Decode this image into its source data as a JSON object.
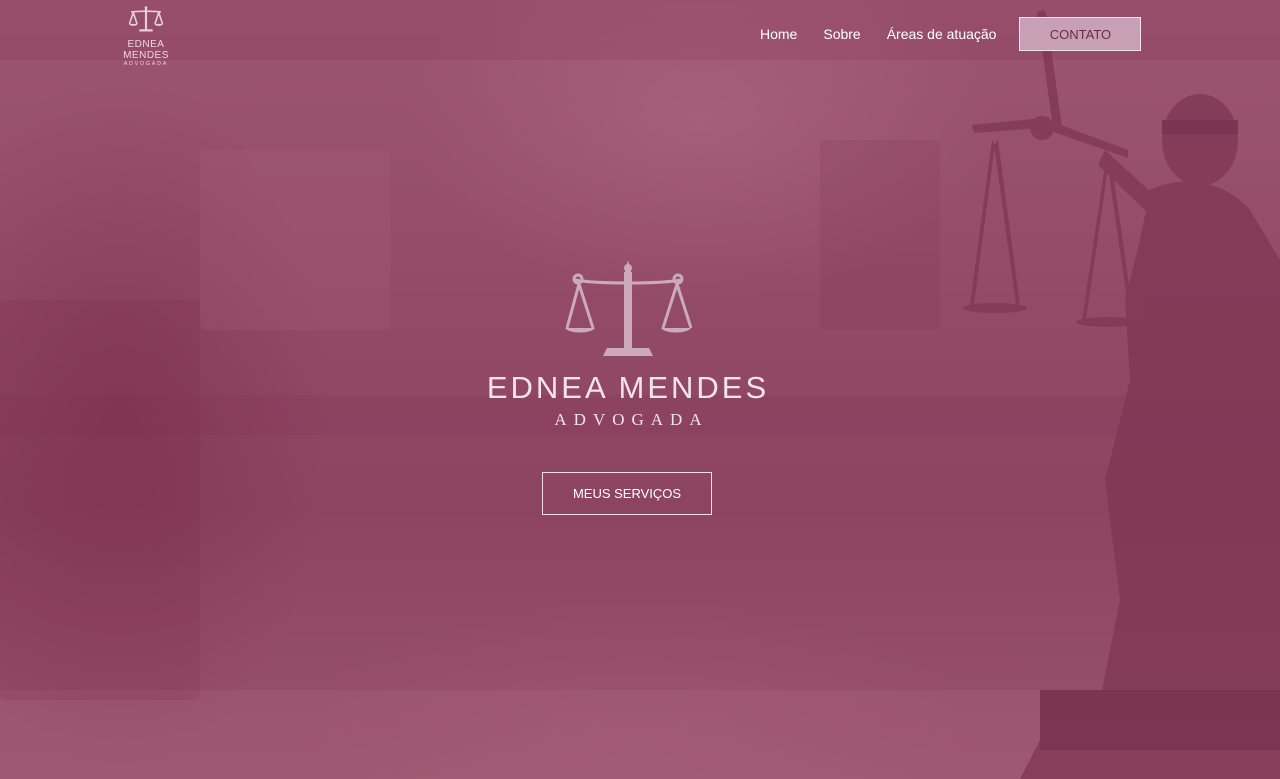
{
  "brand": {
    "name": "EDNEA MENDES",
    "subtitle": "ADVOGADA",
    "logo_icon": "scales-of-justice-icon"
  },
  "nav": {
    "items": [
      {
        "label": "Home"
      },
      {
        "label": "Sobre"
      },
      {
        "label": "Áreas de atuação"
      }
    ],
    "contact_label": "CONTATO"
  },
  "hero": {
    "cta_label": "MEUS SERVIÇOS",
    "background_image": "lady-justice-statue"
  },
  "colors": {
    "overlay": "#9a4f6b",
    "accent_button": "#c8a0b5",
    "text": "#ffffff"
  }
}
